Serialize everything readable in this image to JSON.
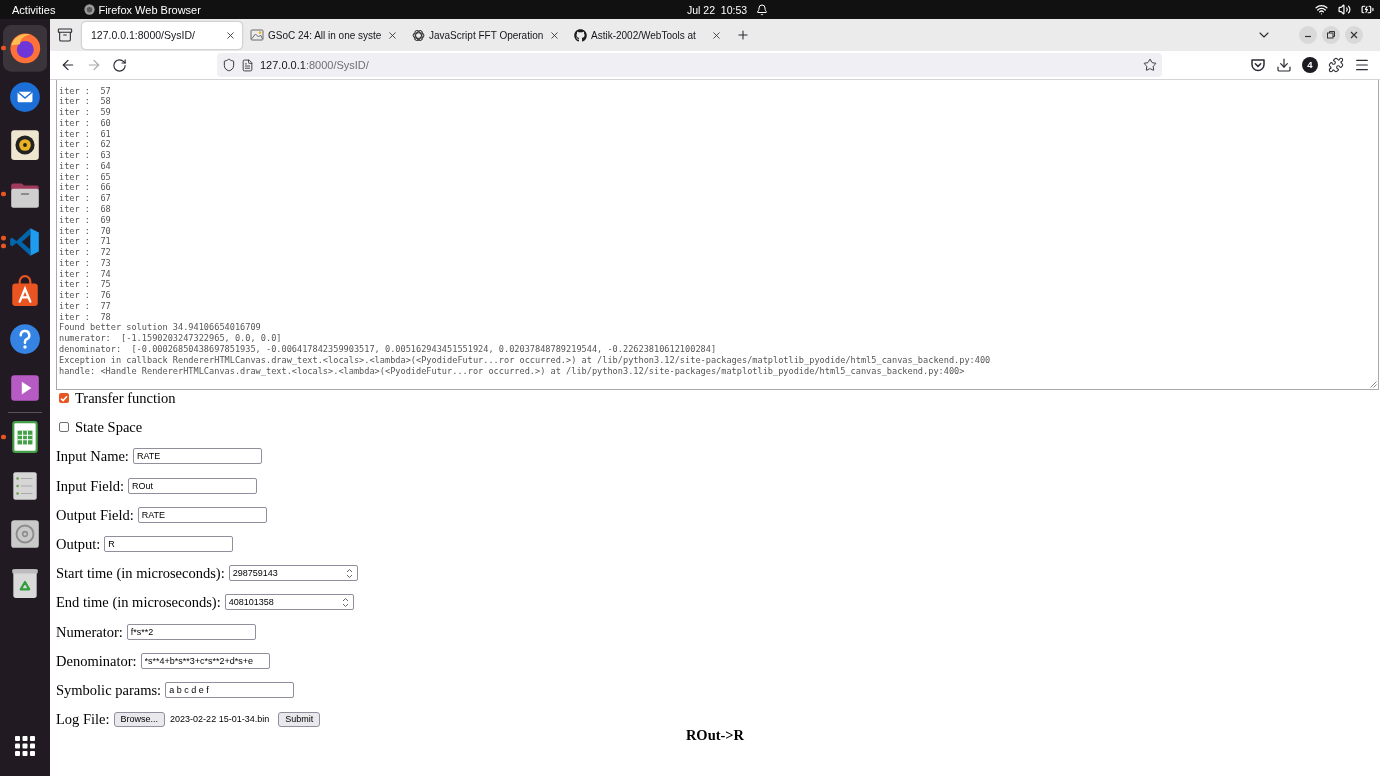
{
  "top_bar": {
    "activities": "Activities",
    "app_menu": "Firefox Web Browser",
    "clock": "Jul 22  10:53"
  },
  "dock": {
    "favorites": [
      {
        "kind": "browser",
        "running": true,
        "multiple_windows": false,
        "selected": true
      },
      {
        "kind": "mail",
        "running": false,
        "multiple_windows": false,
        "selected": false
      },
      {
        "kind": "music",
        "running": false,
        "multiple_windows": false,
        "selected": false
      },
      {
        "kind": "files",
        "running": true,
        "multiple_windows": false,
        "selected": false
      },
      {
        "kind": "code",
        "running": true,
        "multiple_windows": true,
        "selected": false
      },
      {
        "kind": "store",
        "running": false,
        "multiple_windows": false,
        "selected": false
      },
      {
        "kind": "help",
        "running": false,
        "multiple_windows": false,
        "selected": false
      },
      {
        "kind": "videos",
        "running": false,
        "multiple_windows": false,
        "selected": false
      }
    ],
    "others": [
      {
        "kind": "spreadsheet",
        "running": true,
        "multiple_windows": false,
        "selected": false
      },
      {
        "kind": "drive",
        "running": false,
        "multiple_windows": false,
        "selected": false
      },
      {
        "kind": "disc",
        "running": false,
        "multiple_windows": false,
        "selected": false
      },
      {
        "kind": "trash",
        "running": false,
        "multiple_windows": false,
        "selected": false
      }
    ]
  },
  "tabs": [
    {
      "kind": "blank",
      "title": "127.0.0.1:8000/SysID/",
      "selected": true
    },
    {
      "kind": "picture",
      "title": "GSoC 24: All in one syste",
      "selected": false
    },
    {
      "kind": "knot",
      "title": "JavaScript FFT Operation",
      "selected": false
    },
    {
      "kind": "cat",
      "title": "Astik-2002/WebTools at",
      "selected": false
    }
  ],
  "nav": {
    "back": {
      "disabled": false
    },
    "forward": {
      "disabled": true
    },
    "url_host": "127.0.0.1",
    "url_path": ":8000/SysID/",
    "extensions_count": "4"
  },
  "log": {
    "lines": [
      "iter :  57",
      "iter :  58",
      "iter :  59",
      "iter :  60",
      "iter :  61",
      "iter :  62",
      "iter :  63",
      "iter :  64",
      "iter :  65",
      "iter :  66",
      "iter :  67",
      "iter :  68",
      "iter :  69",
      "iter :  70",
      "iter :  71",
      "iter :  72",
      "iter :  73",
      "iter :  74",
      "iter :  75",
      "iter :  76",
      "iter :  77",
      "iter :  78",
      "Found better solution 34.94106654016709",
      "numerator:  [-1.1590203247322965, 0.0, 0.0]",
      "denominator:  [-0.00026850438697851935, -0.006417842359903517, 0.005162943451551924, 0.02037848789219544, -0.22623810612100284]",
      "Exception in callback RendererHTMLCanvas.draw_text.<locals>.<lambda>(<PyodideFutur...ror occurred.>) at /lib/python3.12/site-packages/matplotlib_pyodide/html5_canvas_backend.py:400",
      "handle: <Handle RendererHTMLCanvas.draw_text.<locals>.<lambda>(<PyodideFutur...ror occurred.>) at /lib/python3.12/site-packages/matplotlib_pyodide/html5_canvas_backend.py:400>"
    ]
  },
  "form": {
    "checkboxes": [
      {
        "label": "Transfer function",
        "checked": true
      },
      {
        "label": "State Space",
        "checked": false
      }
    ],
    "fields": [
      {
        "label": "Input Name:",
        "value": "RATE",
        "kind": "text"
      },
      {
        "label": "Input Field:",
        "value": "ROut",
        "kind": "text"
      },
      {
        "label": "Output Field:",
        "value": "RATE",
        "kind": "text"
      },
      {
        "label": "Output:",
        "value": "R",
        "kind": "text"
      },
      {
        "label": "Start time (in microseconds):",
        "value": "298759143",
        "kind": "number"
      },
      {
        "label": "End time (in microseconds):",
        "value": "408101358",
        "kind": "number"
      },
      {
        "label": "Numerator:",
        "value": "f*s**2",
        "kind": "text"
      },
      {
        "label": "Denominator:",
        "value": "*s**4+b*s**3+c*s**2+d*s+e",
        "kind": "text"
      },
      {
        "label": "Symbolic params:",
        "value": "a b c d e f",
        "kind": "text"
      }
    ],
    "file": {
      "label": "Log File:",
      "button": "Browse...",
      "filename": "2023-02-22 15-01-34.bin"
    },
    "submit": "Submit"
  },
  "result_title": "ROut->R"
}
